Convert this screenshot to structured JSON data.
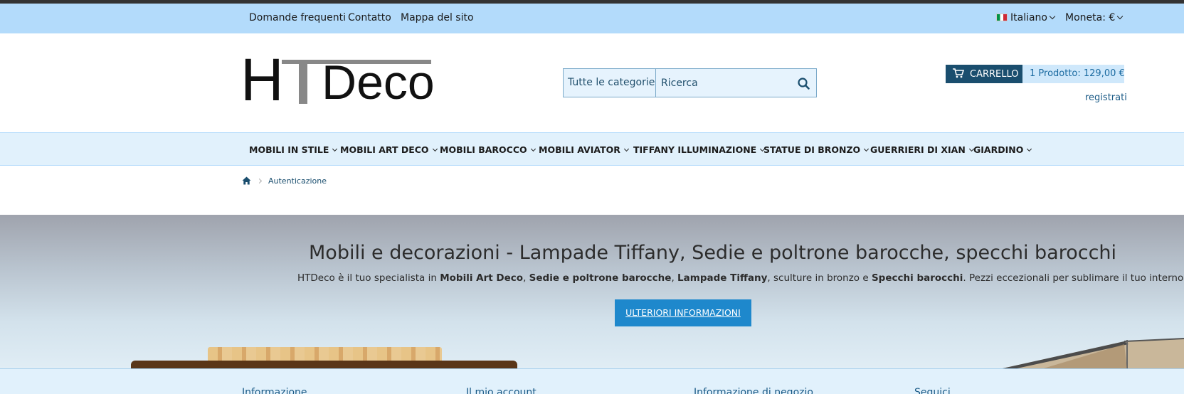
{
  "topbar": {
    "links": [
      "Domande frequenti",
      "Contatto",
      "Mappa del sito"
    ],
    "language": "Italiano",
    "currency": "Moneta: €"
  },
  "logo": {
    "text_h": "H",
    "text_deco": "Deco"
  },
  "search": {
    "category": "Tutte le categorie",
    "placeholder": "Ricerca"
  },
  "cart": {
    "label": "CARRELLO",
    "summary": "1 Prodotto: 129,00 €"
  },
  "account": {
    "register": "registrati"
  },
  "nav": {
    "items": [
      "MOBILI IN STILE",
      "MOBILI ART DECO",
      "MOBILI BAROCCO",
      "MOBILI AVIATOR",
      "TIFFANY ILLUMINAZIONE",
      "STATUE DI BRONZO",
      "GUERRIERI DI XIAN",
      "GIARDINO"
    ]
  },
  "breadcrumb": {
    "current": "Autenticazione"
  },
  "hero": {
    "title": "Mobili e decorazioni - Lampade Tiffany, Sedie e poltrone barocche, specchi barocchi",
    "sub_1": "HTDeco è il tuo specialista in ",
    "sub_b1": "Mobili Art Deco",
    "sub_2": ", ",
    "sub_b2": "Sedie e poltrone barocche",
    "sub_3": ", ",
    "sub_b3": "Lampade Tiffany",
    "sub_4": ", sculture in bronzo e ",
    "sub_b4": "Specchi barocchi",
    "sub_5": ". Pezzi eccezionali per sublimare il tuo interno.",
    "cta": "ULTERIORI INFORMAZIONI"
  },
  "footer": {
    "columns": [
      "Informazione",
      "Il mio account",
      "Informazione di negozio",
      "Seguici"
    ]
  },
  "colors": {
    "topbar": "#b3dbfb",
    "nav": "#e1f1fc",
    "cart_dark": "#1a4e6e",
    "cta": "#1e88cc"
  },
  "icons": {
    "search": "search-icon",
    "cart": "cart-icon",
    "home": "home-icon",
    "flag": "italy-flag-icon"
  }
}
